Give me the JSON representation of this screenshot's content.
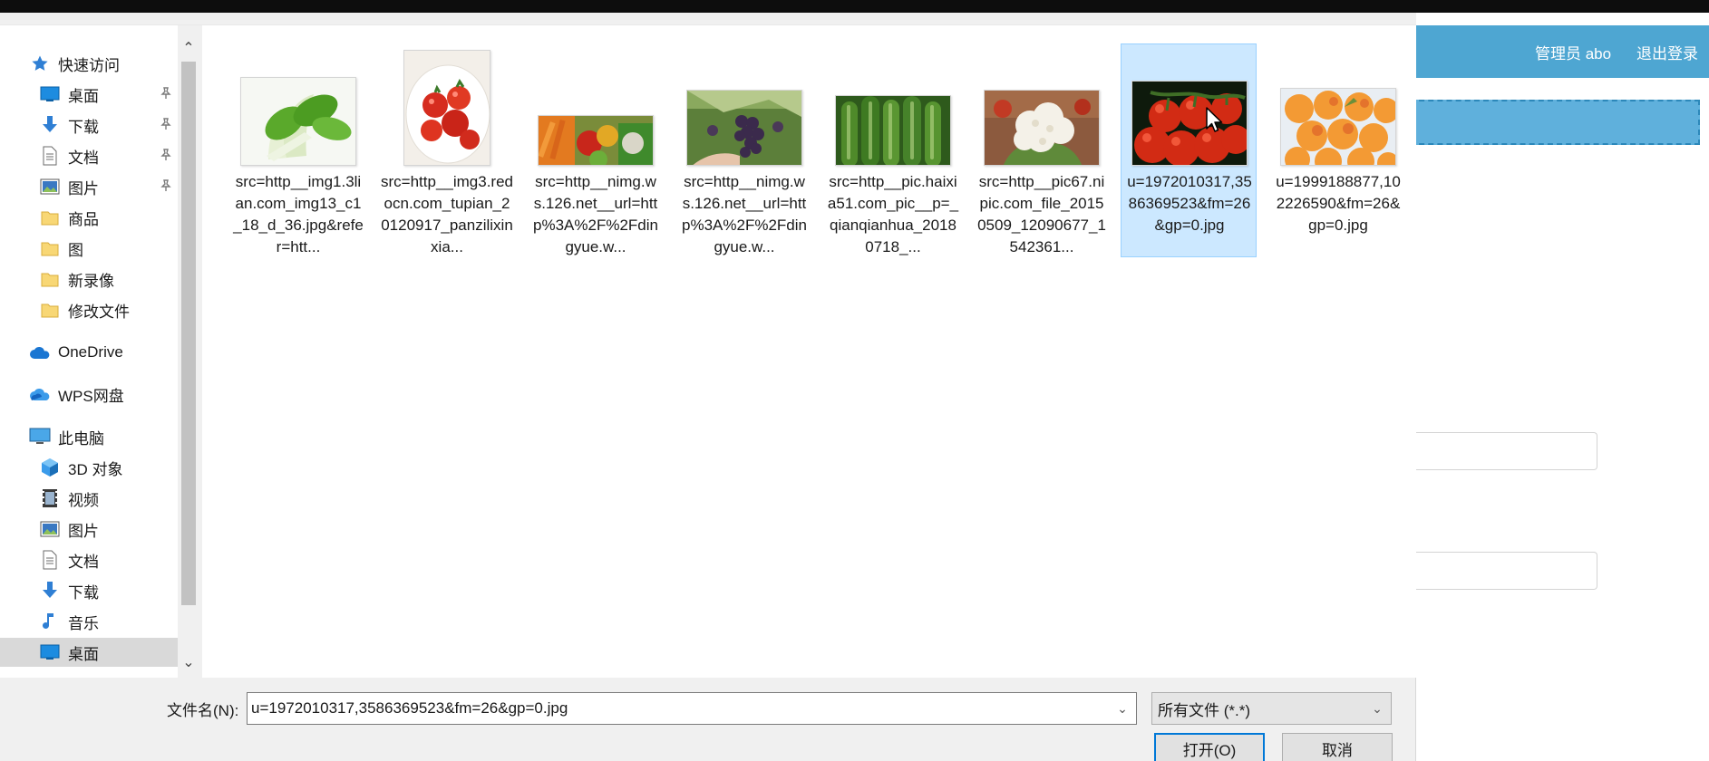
{
  "background_page": {
    "admin_label": "管理员 abo",
    "logout_label": "退出登录"
  },
  "nav": {
    "items": [
      {
        "label": "快速访问",
        "icon": "star-icon",
        "pinned": false
      },
      {
        "label": "桌面",
        "icon": "desktop-icon",
        "pinned": true
      },
      {
        "label": "下载",
        "icon": "download-icon",
        "pinned": true
      },
      {
        "label": "文档",
        "icon": "document-icon",
        "pinned": true
      },
      {
        "label": "图片",
        "icon": "pictures-icon",
        "pinned": true
      },
      {
        "label": "商品",
        "icon": "folder-icon",
        "pinned": false
      },
      {
        "label": "图",
        "icon": "folder-icon",
        "pinned": false
      },
      {
        "label": "新录像",
        "icon": "folder-icon",
        "pinned": false
      },
      {
        "label": "修改文件",
        "icon": "folder-icon",
        "pinned": false
      },
      {
        "label": "OneDrive",
        "icon": "onedrive-cloud-icon",
        "pinned": false
      },
      {
        "label": "WPS网盘",
        "icon": "wps-cloud-icon",
        "pinned": false
      },
      {
        "label": "此电脑",
        "icon": "computer-icon",
        "pinned": false
      },
      {
        "label": "3D 对象",
        "icon": "3d-objects-icon",
        "pinned": false
      },
      {
        "label": "视频",
        "icon": "video-icon",
        "pinned": false
      },
      {
        "label": "图片",
        "icon": "pictures-icon",
        "pinned": false
      },
      {
        "label": "文档",
        "icon": "document-icon",
        "pinned": false
      },
      {
        "label": "下载",
        "icon": "download-icon",
        "pinned": false
      },
      {
        "label": "音乐",
        "icon": "music-icon",
        "pinned": false
      },
      {
        "label": "桌面",
        "icon": "desktop-icon",
        "pinned": false,
        "selected": true
      }
    ]
  },
  "files": [
    {
      "name": "src=http__img1.3lian.com_img13_c1_18_d_36.jpg&refer=htt...",
      "thumb": "bok-choy"
    },
    {
      "name": "src=http__img3.redocn.com_tupian_20120917_panzilixinxia...",
      "thumb": "tomatoes-plate"
    },
    {
      "name": "src=http__nimg.ws.126.net__url=http%3A%2F%2Fdingyue.w...",
      "thumb": "vegetables"
    },
    {
      "name": "src=http__nimg.ws.126.net__url=http%3A%2F%2Fdingyue.w...",
      "thumb": "grapes"
    },
    {
      "name": "src=http__pic.haixia51.com_pic__p=_qianqianhua_20180718_...",
      "thumb": "cucumbers"
    },
    {
      "name": "src=http__pic67.nipic.com_file_20150509_12090677_1542361...",
      "thumb": "cauliflower"
    },
    {
      "name": "u=1972010317,3586369523&fm=26&gp=0.jpg",
      "thumb": "tomatoes-vine",
      "selected": true
    },
    {
      "name": "u=1999188877,102226590&fm=26&gp=0.jpg",
      "thumb": "apricots"
    }
  ],
  "bottom": {
    "filename_label": "文件名(N):",
    "filename_value": "u=1972010317,3586369523&fm=26&gp=0.jpg",
    "filetype_value": "所有文件 (*.*)",
    "open_label": "打开(O)",
    "cancel_label": "取消"
  }
}
